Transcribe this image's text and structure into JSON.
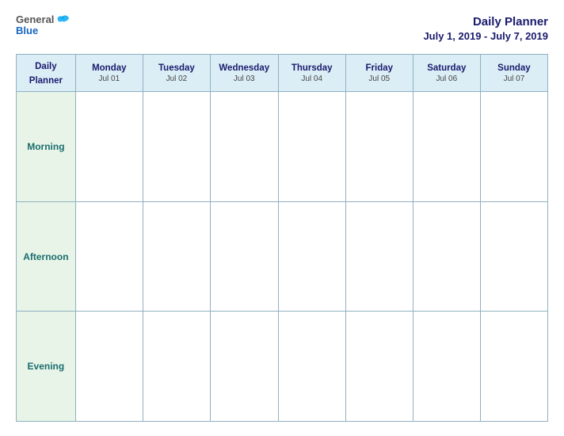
{
  "logo": {
    "general": "General",
    "blue": "Blue",
    "bird_label": "blue-bird-logo"
  },
  "header": {
    "title": "Daily Planner",
    "date_range": "July 1, 2019 - July 7, 2019"
  },
  "table": {
    "label_col": {
      "line1": "Daily",
      "line2": "Planner"
    },
    "days": [
      {
        "name": "Monday",
        "date": "Jul 01"
      },
      {
        "name": "Tuesday",
        "date": "Jul 02"
      },
      {
        "name": "Wednesday",
        "date": "Jul 03"
      },
      {
        "name": "Thursday",
        "date": "Jul 04"
      },
      {
        "name": "Friday",
        "date": "Jul 05"
      },
      {
        "name": "Saturday",
        "date": "Jul 06"
      },
      {
        "name": "Sunday",
        "date": "Jul 07"
      }
    ],
    "rows": [
      {
        "label": "Morning"
      },
      {
        "label": "Afternoon"
      },
      {
        "label": "Evening"
      }
    ]
  }
}
